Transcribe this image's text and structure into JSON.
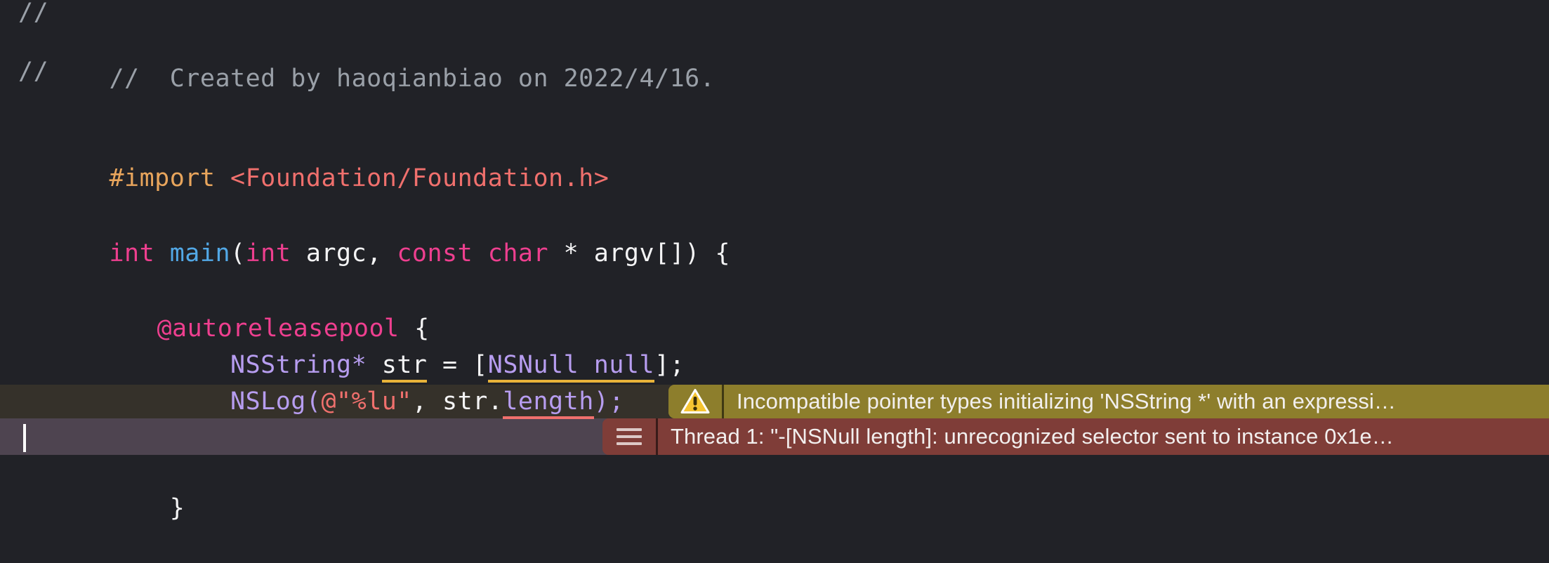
{
  "editor": {
    "language": "objective-c",
    "background_color": "#212227",
    "font_size_px": 35,
    "line_height_px": 52
  },
  "code": {
    "line_1": "//",
    "line_2_slashes": "//",
    "line_2_text": "  Created by haoqianbiao on 2022/4/16.",
    "line_3": "//",
    "import_keyword": "#import",
    "import_path": " <Foundation/Foundation.h>",
    "main_int": "int",
    "main_space1": " ",
    "main_name": "main",
    "main_paren_open": "(",
    "main_argc_type": "int",
    "main_argc": " argc",
    "main_comma": ", ",
    "main_const": "const",
    "main_space2": " ",
    "main_char": "char",
    "main_argv": " * argv[]) {",
    "autoreleasepool": "@autoreleasepool",
    "autoreleasepool_brace": " {",
    "nsstring_indent": "        ",
    "nsstring_type": "NSString",
    "nsstring_star": "* ",
    "nsstring_var": "str",
    "nsstring_assign": " = [",
    "nsstring_class": "NSNull null",
    "nsstring_close": "];",
    "nslog_indent": "        ",
    "nslog_name": "NSLog",
    "nslog_paren": "(",
    "nslog_string": "@\"%lu\"",
    "nslog_comma": ", ",
    "nslog_var": "str",
    "nslog_dot": ".",
    "nslog_prop": "length",
    "nslog_close": ");",
    "closing_brace_indent": "    ",
    "closing_brace": "}"
  },
  "diagnostics": {
    "warning": {
      "severity": "warning",
      "icon": "warning-triangle-icon",
      "message": "Incompatible pointer types initializing 'NSString *' with an expressi…",
      "background_color": "#8d7e2c",
      "row_background_color": "#35312a",
      "icon_color": "#f5c431"
    },
    "error": {
      "severity": "error",
      "icon": "hamburger-menu-icon",
      "message": "Thread 1: \"-[NSNull length]: unrecognized selector sent to instance 0x1e…",
      "background_color": "#7f3d38",
      "row_background_color": "#4e4450",
      "icon_color": "#ddc9c7"
    }
  }
}
